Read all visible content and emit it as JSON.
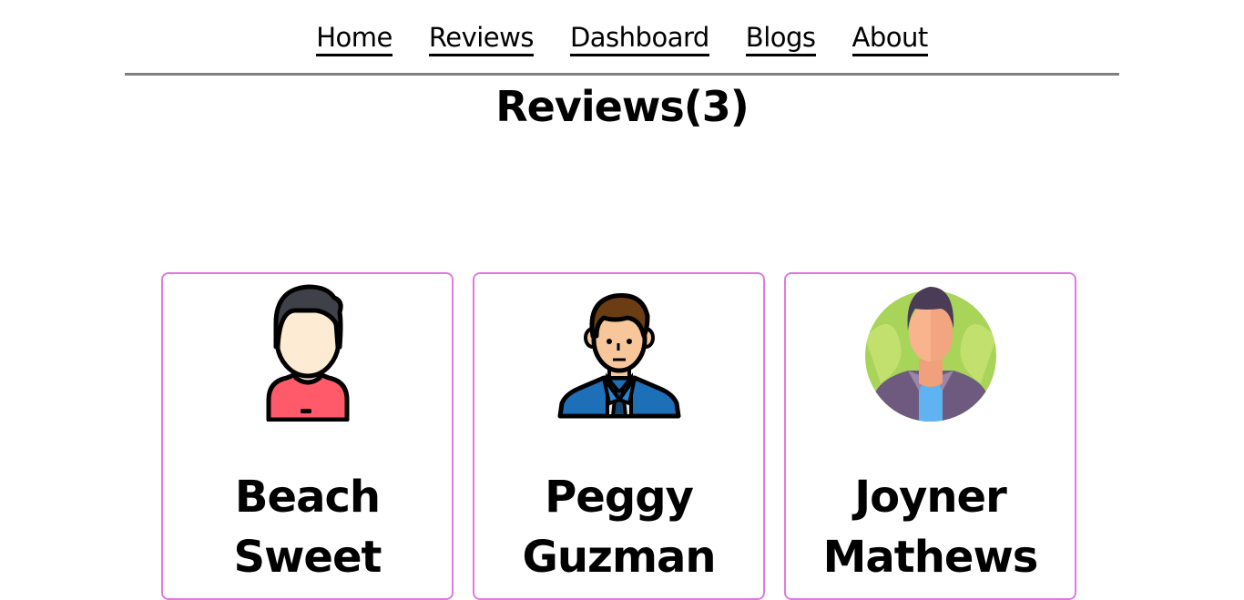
{
  "nav": {
    "items": [
      {
        "label": "Home"
      },
      {
        "label": "Reviews"
      },
      {
        "label": "Dashboard"
      },
      {
        "label": "Blogs"
      },
      {
        "label": "About"
      }
    ]
  },
  "page": {
    "title": "Reviews(3)"
  },
  "reviews": [
    {
      "first": "Beach",
      "last": "Sweet",
      "avatar": "man-red-shirt-avatar-icon"
    },
    {
      "first": "Peggy",
      "last": "Guzman",
      "avatar": "businessman-blue-suit-avatar-icon"
    },
    {
      "first": "Joyner",
      "last": "Mathews",
      "avatar": "man-circle-green-background-avatar-icon"
    }
  ],
  "colors": {
    "card_border": "#e07ae0",
    "nav_divider": "#808080"
  }
}
